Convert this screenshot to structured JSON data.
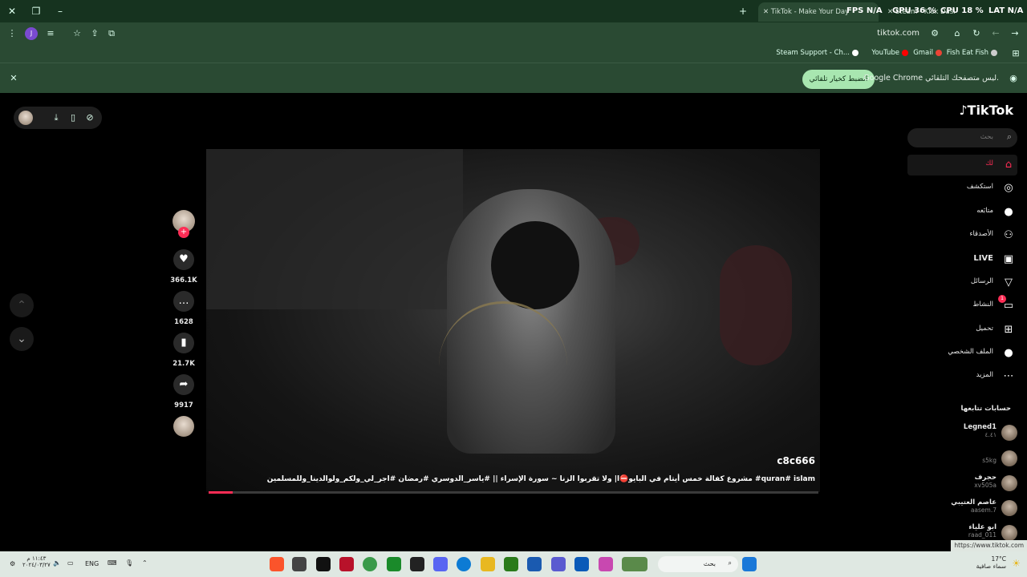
{
  "browser": {
    "tabs": [
      {
        "label": "TikTok - Make Your Day",
        "active": true
      },
      {
        "label": "Steam - Kick Dashboard",
        "active": false
      }
    ],
    "hud": {
      "fps": "FPS",
      "fps_val": "N/A",
      "gpu": "GPU",
      "gpu_val": "36 %",
      "cpu": "CPU",
      "cpu_val": "18 %",
      "lat": "LAT",
      "lat_val": "N/A"
    },
    "url": "tiktok.com",
    "bookmarks": [
      {
        "label": "Steam Support - Ch...",
        "color": "#ffffff"
      },
      {
        "label": "YouTube",
        "color": "#ff0000"
      },
      {
        "label": "Gmail",
        "color": "#ea4335"
      },
      {
        "label": "Fish Eat Fish",
        "color": "#cccccc"
      }
    ],
    "infobar": {
      "message": "Google Chrome ليس متصفحك التلقائي.",
      "button": "الضبط كخيار تلقائي"
    }
  },
  "tiktok": {
    "logo": "TikTok",
    "search_placeholder": "بحث",
    "nav": [
      {
        "label": "لك",
        "icon": "home-icon",
        "glyph": "⌂",
        "active": true
      },
      {
        "label": "استكشف",
        "icon": "compass-icon",
        "glyph": "◎"
      },
      {
        "label": "متابَعه",
        "icon": "following-avatar-icon",
        "glyph": "●"
      },
      {
        "label": "الأصدقاء",
        "icon": "friends-icon",
        "glyph": "⚇"
      },
      {
        "label": "LIVE",
        "icon": "live-icon",
        "glyph": "▣"
      },
      {
        "label": "الرسائل",
        "icon": "send-icon",
        "glyph": "▽"
      },
      {
        "label": "النشاط",
        "icon": "activity-icon",
        "glyph": "▭",
        "badge": "1"
      },
      {
        "label": "تحميل",
        "icon": "upload-icon",
        "glyph": "⊞"
      },
      {
        "label": "الملف الشخصي",
        "icon": "profile-avatar-icon",
        "glyph": "●"
      },
      {
        "label": "المزيد",
        "icon": "more-icon",
        "glyph": "⋯"
      }
    ],
    "following_heading": "حسابات تتابعها",
    "following": [
      {
        "name": "Legned1",
        "handle": "٤.٤١"
      },
      {
        "name": "",
        "handle": "s5kg"
      },
      {
        "name": "حجرف",
        "handle": "xv505a"
      },
      {
        "name": "عاصم العتيبي",
        "handle": "aasem.7"
      },
      {
        "name": "ابو علياء",
        "handle": "raad_011"
      }
    ],
    "status_url": "https://www.tiktok.com",
    "video": {
      "author": "c8c666",
      "caption": "مشروع كفالة خمس أيتام في البايو⛔️ا| ولا تقربوا الزنا ~ سورة الإسراء || #ياسر_الدوسري #رمضان #اجر_لي_ولكم_ولوالدينا_وللمسلمين #quran# islam",
      "progress": 0.04
    },
    "actions": [
      {
        "icon": "heart-icon",
        "glyph": "♥",
        "count": "366.1K"
      },
      {
        "icon": "comment-icon",
        "glyph": "…",
        "count": "1628"
      },
      {
        "icon": "bookmark-icon",
        "glyph": "▮",
        "count": "21.7K"
      },
      {
        "icon": "share-icon",
        "glyph": "➦",
        "count": "9917"
      }
    ]
  },
  "taskbar": {
    "search_placeholder": "بحث",
    "language": "ENG",
    "clock_time": "١١:٤٣ م",
    "clock_date": "٢٠٢٤/٠٣/٢٧",
    "weather_temp": "17°C",
    "weather_desc": "سماء صافية"
  }
}
